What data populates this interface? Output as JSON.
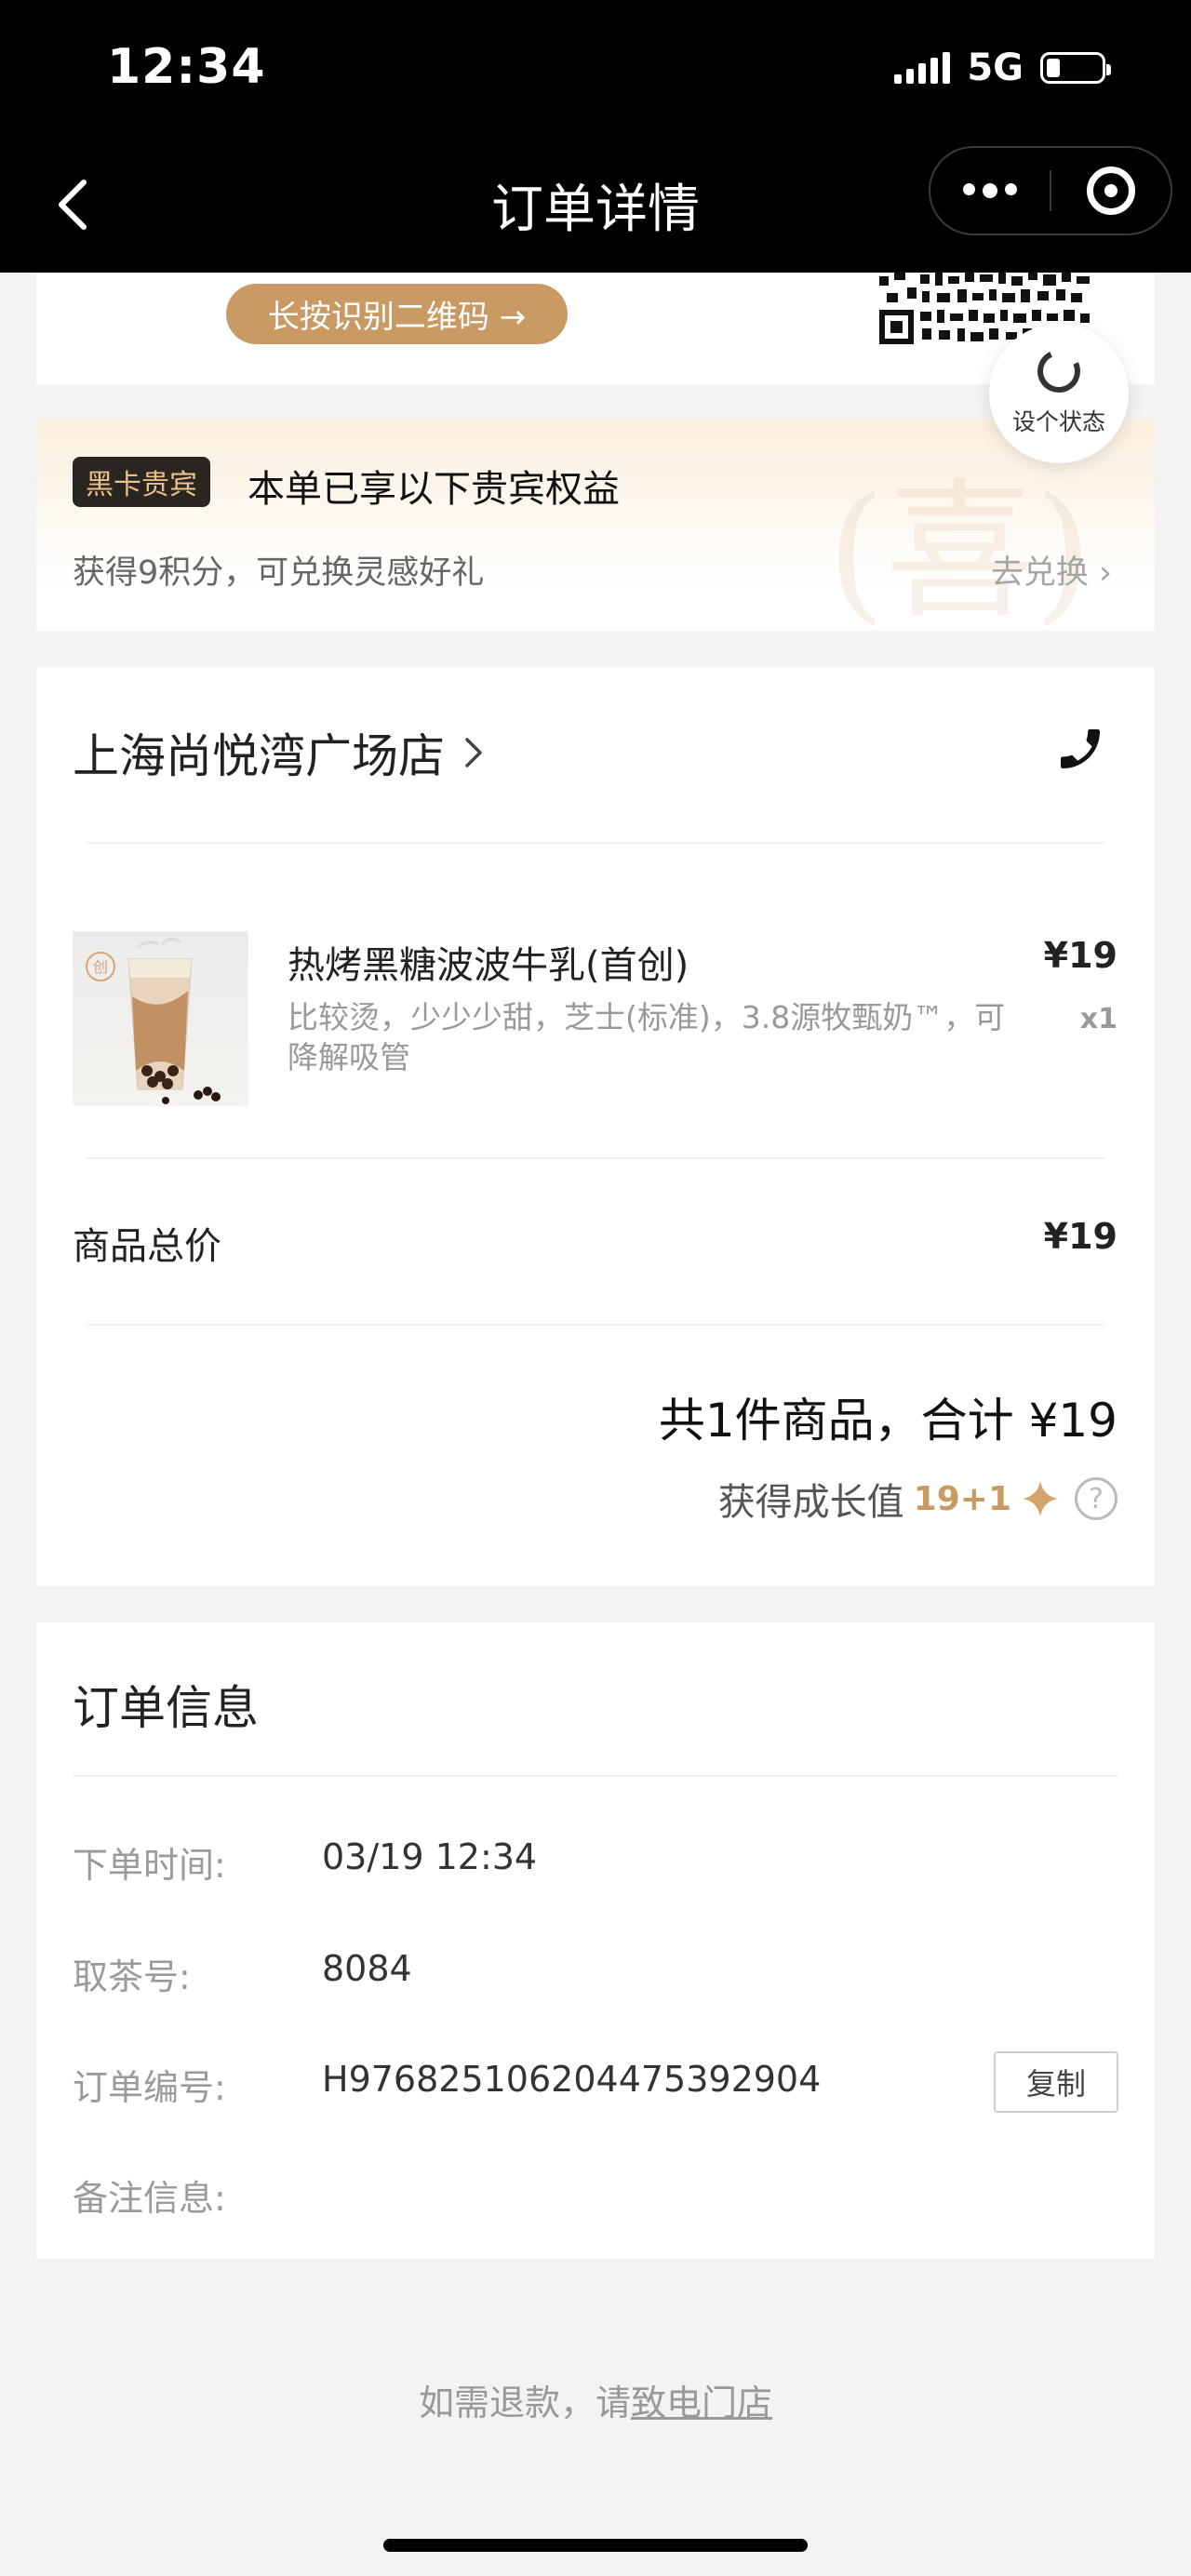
{
  "status_bar": {
    "time": "12:34",
    "network": "5G"
  },
  "nav": {
    "title": "订单详情",
    "icons": [
      "back-icon",
      "more-icon",
      "target-icon"
    ]
  },
  "qr": {
    "button_label": "长按识别二维码 →"
  },
  "status_float": {
    "label": "设个状态"
  },
  "vip": {
    "badge": "黑卡贵宾",
    "title": "本单已享以下贵宾权益",
    "desc": "获得9积分，可兑换灵感好礼",
    "link": "去兑换",
    "watermark": "(喜)"
  },
  "order": {
    "store_name": "上海尚悦湾广场店",
    "item": {
      "name": "热烤黑糖波波牛乳(首创)",
      "spec": "比较烫，少少少甜，芝士(标准)，3.8源牧甄奶™，可降解吸管",
      "price": "¥19",
      "qty": "x1",
      "badge": "创"
    },
    "subtotal_label": "商品总价",
    "subtotal_value": "¥19",
    "total_text": "共1件商品，合计 ¥19",
    "growth_label": "获得成长值",
    "growth_value": "19+1"
  },
  "info": {
    "title": "订单信息",
    "rows": [
      {
        "label": "下单时间:",
        "value": "03/19 12:34"
      },
      {
        "label": "取茶号:",
        "value": "8084"
      },
      {
        "label": "订单编号:",
        "value": "H976825106204475392904"
      },
      {
        "label": "备注信息:",
        "value": ""
      }
    ],
    "copy_label": "复制"
  },
  "footer": {
    "refund_prefix": "如需退款，请",
    "refund_link": "致电门店"
  },
  "colors": {
    "accent": "#c99a63",
    "vip_badge_bg": "#2a2520",
    "vip_badge_text": "#e8c08a"
  }
}
